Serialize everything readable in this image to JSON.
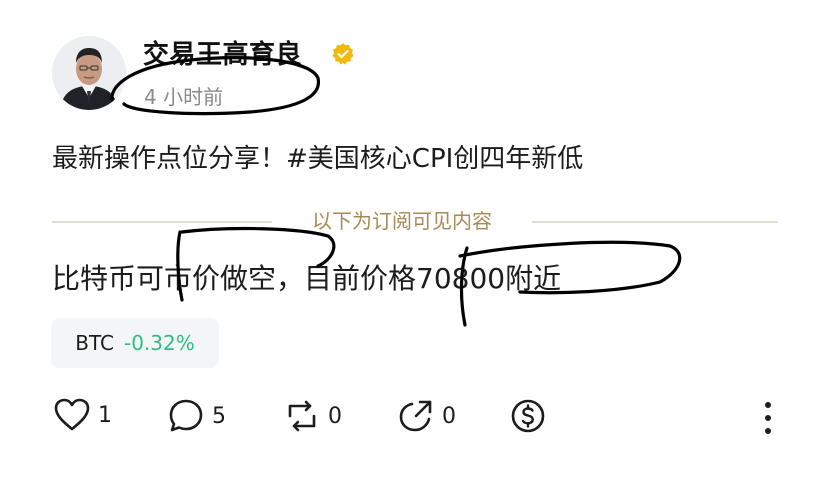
{
  "post": {
    "author": {
      "name": "交易王高育良",
      "avatar": "portrait-of-man-in-suit",
      "verified_badge": "gold-verified-check-icon"
    },
    "timestamp": "4 小时前",
    "text": "最新操作点位分享！#美国核心CPI创四年新低",
    "paywall_divider": "以下为订阅可见内容",
    "paywall_text": "比特币可市价做空，目前价格70800附近"
  },
  "ticker": {
    "symbol": "BTC",
    "change": "-0.32%",
    "change_color": "#2ebd85"
  },
  "actions": {
    "like": {
      "icon": "heart-icon",
      "count": "1"
    },
    "comment": {
      "icon": "comment-icon",
      "count": "5"
    },
    "repost": {
      "icon": "repost-icon",
      "count": "0"
    },
    "share": {
      "icon": "share-icon",
      "count": "0"
    },
    "tip": {
      "icon": "dollar-coin-icon"
    },
    "more": {
      "icon": "more-vertical-icon"
    }
  },
  "colors": {
    "accent_gold": "#a98a55",
    "badge_gold": "#f0b90b",
    "text": "#1c1c1c",
    "muted": "#8a8a8a"
  }
}
